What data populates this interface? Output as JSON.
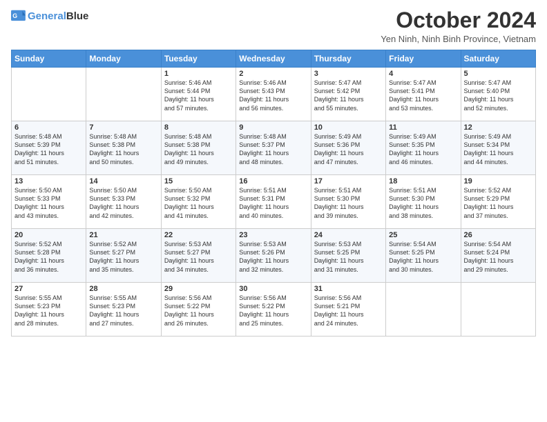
{
  "header": {
    "logo_line1": "General",
    "logo_line2": "Blue",
    "month_title": "October 2024",
    "location": "Yen Ninh, Ninh Binh Province, Vietnam"
  },
  "weekdays": [
    "Sunday",
    "Monday",
    "Tuesday",
    "Wednesday",
    "Thursday",
    "Friday",
    "Saturday"
  ],
  "weeks": [
    [
      {
        "day": "",
        "info": ""
      },
      {
        "day": "",
        "info": ""
      },
      {
        "day": "1",
        "info": "Sunrise: 5:46 AM\nSunset: 5:44 PM\nDaylight: 11 hours\nand 57 minutes."
      },
      {
        "day": "2",
        "info": "Sunrise: 5:46 AM\nSunset: 5:43 PM\nDaylight: 11 hours\nand 56 minutes."
      },
      {
        "day": "3",
        "info": "Sunrise: 5:47 AM\nSunset: 5:42 PM\nDaylight: 11 hours\nand 55 minutes."
      },
      {
        "day": "4",
        "info": "Sunrise: 5:47 AM\nSunset: 5:41 PM\nDaylight: 11 hours\nand 53 minutes."
      },
      {
        "day": "5",
        "info": "Sunrise: 5:47 AM\nSunset: 5:40 PM\nDaylight: 11 hours\nand 52 minutes."
      }
    ],
    [
      {
        "day": "6",
        "info": "Sunrise: 5:48 AM\nSunset: 5:39 PM\nDaylight: 11 hours\nand 51 minutes."
      },
      {
        "day": "7",
        "info": "Sunrise: 5:48 AM\nSunset: 5:38 PM\nDaylight: 11 hours\nand 50 minutes."
      },
      {
        "day": "8",
        "info": "Sunrise: 5:48 AM\nSunset: 5:38 PM\nDaylight: 11 hours\nand 49 minutes."
      },
      {
        "day": "9",
        "info": "Sunrise: 5:48 AM\nSunset: 5:37 PM\nDaylight: 11 hours\nand 48 minutes."
      },
      {
        "day": "10",
        "info": "Sunrise: 5:49 AM\nSunset: 5:36 PM\nDaylight: 11 hours\nand 47 minutes."
      },
      {
        "day": "11",
        "info": "Sunrise: 5:49 AM\nSunset: 5:35 PM\nDaylight: 11 hours\nand 46 minutes."
      },
      {
        "day": "12",
        "info": "Sunrise: 5:49 AM\nSunset: 5:34 PM\nDaylight: 11 hours\nand 44 minutes."
      }
    ],
    [
      {
        "day": "13",
        "info": "Sunrise: 5:50 AM\nSunset: 5:33 PM\nDaylight: 11 hours\nand 43 minutes."
      },
      {
        "day": "14",
        "info": "Sunrise: 5:50 AM\nSunset: 5:33 PM\nDaylight: 11 hours\nand 42 minutes."
      },
      {
        "day": "15",
        "info": "Sunrise: 5:50 AM\nSunset: 5:32 PM\nDaylight: 11 hours\nand 41 minutes."
      },
      {
        "day": "16",
        "info": "Sunrise: 5:51 AM\nSunset: 5:31 PM\nDaylight: 11 hours\nand 40 minutes."
      },
      {
        "day": "17",
        "info": "Sunrise: 5:51 AM\nSunset: 5:30 PM\nDaylight: 11 hours\nand 39 minutes."
      },
      {
        "day": "18",
        "info": "Sunrise: 5:51 AM\nSunset: 5:30 PM\nDaylight: 11 hours\nand 38 minutes."
      },
      {
        "day": "19",
        "info": "Sunrise: 5:52 AM\nSunset: 5:29 PM\nDaylight: 11 hours\nand 37 minutes."
      }
    ],
    [
      {
        "day": "20",
        "info": "Sunrise: 5:52 AM\nSunset: 5:28 PM\nDaylight: 11 hours\nand 36 minutes."
      },
      {
        "day": "21",
        "info": "Sunrise: 5:52 AM\nSunset: 5:27 PM\nDaylight: 11 hours\nand 35 minutes."
      },
      {
        "day": "22",
        "info": "Sunrise: 5:53 AM\nSunset: 5:27 PM\nDaylight: 11 hours\nand 34 minutes."
      },
      {
        "day": "23",
        "info": "Sunrise: 5:53 AM\nSunset: 5:26 PM\nDaylight: 11 hours\nand 32 minutes."
      },
      {
        "day": "24",
        "info": "Sunrise: 5:53 AM\nSunset: 5:25 PM\nDaylight: 11 hours\nand 31 minutes."
      },
      {
        "day": "25",
        "info": "Sunrise: 5:54 AM\nSunset: 5:25 PM\nDaylight: 11 hours\nand 30 minutes."
      },
      {
        "day": "26",
        "info": "Sunrise: 5:54 AM\nSunset: 5:24 PM\nDaylight: 11 hours\nand 29 minutes."
      }
    ],
    [
      {
        "day": "27",
        "info": "Sunrise: 5:55 AM\nSunset: 5:23 PM\nDaylight: 11 hours\nand 28 minutes."
      },
      {
        "day": "28",
        "info": "Sunrise: 5:55 AM\nSunset: 5:23 PM\nDaylight: 11 hours\nand 27 minutes."
      },
      {
        "day": "29",
        "info": "Sunrise: 5:56 AM\nSunset: 5:22 PM\nDaylight: 11 hours\nand 26 minutes."
      },
      {
        "day": "30",
        "info": "Sunrise: 5:56 AM\nSunset: 5:22 PM\nDaylight: 11 hours\nand 25 minutes."
      },
      {
        "day": "31",
        "info": "Sunrise: 5:56 AM\nSunset: 5:21 PM\nDaylight: 11 hours\nand 24 minutes."
      },
      {
        "day": "",
        "info": ""
      },
      {
        "day": "",
        "info": ""
      }
    ]
  ]
}
